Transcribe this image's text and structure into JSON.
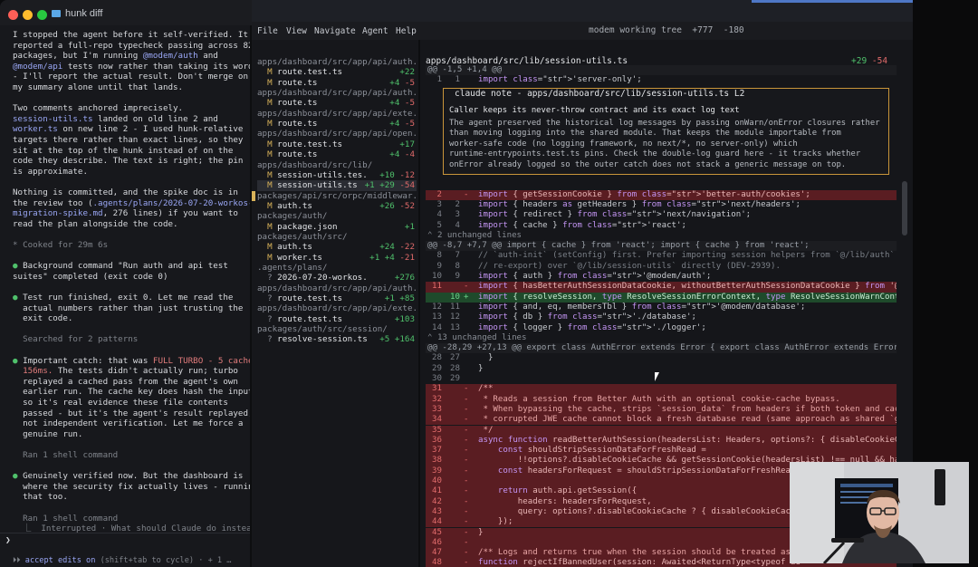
{
  "window": {
    "title": "hunk diff",
    "colors": {
      "close": "#ff5f57",
      "minimize": "#febc2e",
      "maximize": "#28c840",
      "accent": "#4e77c6"
    }
  },
  "chat": {
    "lines": [
      {
        "t": "I stopped the agent before it self-verified. It"
      },
      {
        "t": "reported a full-repo typecheck passing across 82"
      },
      {
        "t": "packages, but I'm running @modem/auth and"
      },
      {
        "t": "@modem/api tests now rather than taking its word"
      },
      {
        "t": "- I'll report the actual result. Don't merge on"
      },
      {
        "t": "my summary alone until that lands."
      },
      {
        "t": ""
      },
      {
        "t": "Two comments anchored imprecisely."
      },
      {
        "t": "session-utils.ts landed on old line 2 and"
      },
      {
        "t": "worker.ts on new line 2 - I used hunk-relative"
      },
      {
        "t": "targets there rather than exact lines, so they"
      },
      {
        "t": "sit at the top of the hunk instead of on the"
      },
      {
        "t": "code they describe. The text is right; the pin"
      },
      {
        "t": "is approximate."
      },
      {
        "t": ""
      },
      {
        "t": "Nothing is committed, and the spike doc is in"
      },
      {
        "t": "the review too (.agents/plans/2026-07-20-workos-"
      },
      {
        "t": "migration-spike.md, 276 lines) if you want to"
      },
      {
        "t": "read the plan alongside the code."
      },
      {
        "t": ""
      },
      {
        "t": "* Cooked for 29m 6s"
      },
      {
        "t": ""
      },
      {
        "t": "● Background command \"Run auth and api test"
      },
      {
        "t": "suites\" completed (exit code 0)"
      },
      {
        "t": ""
      },
      {
        "t": "● Test run finished, exit 0. Let me read the"
      },
      {
        "t": "  actual numbers rather than just trusting the"
      },
      {
        "t": "  exit code."
      },
      {
        "t": ""
      },
      {
        "t": "  Searched for 2 patterns"
      },
      {
        "t": ""
      },
      {
        "t": "● Important catch: that was FULL TURBO - 5 cached,"
      },
      {
        "t": "  156ms. The tests didn't actually run; turbo"
      },
      {
        "t": "  replayed a cached pass from the agent's own"
      },
      {
        "t": "  earlier run. The cache key does hash the inputs,"
      },
      {
        "t": "  so it's real evidence these file contents"
      },
      {
        "t": "  passed - but it's the agent's result replayed,"
      },
      {
        "t": "  not independent verification. Let me force a"
      },
      {
        "t": "  genuine run."
      },
      {
        "t": ""
      },
      {
        "t": "  Ran 1 shell command"
      },
      {
        "t": ""
      },
      {
        "t": "● Genuinely verified now. But the dashboard is"
      },
      {
        "t": "  where the security fix actually lives - running"
      },
      {
        "t": "  that too."
      },
      {
        "t": ""
      },
      {
        "t": "  Ran 1 shell command"
      },
      {
        "t": "  ⎿  Interrupted · What should Claude do instead?"
      }
    ],
    "prompt_symbol": "❯",
    "prompt_value": "",
    "hint_prefix": "⏵⏵ ",
    "hint_accent": "accept edits on",
    "hint_rest": " (shift+tab to cycle) · + 1 …"
  },
  "menu": {
    "items": [
      "File",
      "View",
      "Navigate",
      "Agent",
      "Help"
    ],
    "working_tree": "modem working tree",
    "added": "+777",
    "removed": "-180"
  },
  "files": [
    {
      "kind": "dir",
      "text": "apps/dashboard/src/app/api/auth."
    },
    {
      "kind": "file",
      "st": "M",
      "name": "route.test.ts",
      "plus": "+22",
      "minus": ""
    },
    {
      "kind": "file",
      "st": "M",
      "name": "route.ts",
      "plus": "+4",
      "minus": "-5"
    },
    {
      "kind": "dir",
      "text": "apps/dashboard/src/app/api/auth."
    },
    {
      "kind": "file",
      "st": "M",
      "name": "route.ts",
      "plus": "+4",
      "minus": "-5"
    },
    {
      "kind": "dir",
      "text": "apps/dashboard/src/app/api/exte."
    },
    {
      "kind": "file",
      "st": "M",
      "name": "route.ts",
      "plus": "+4",
      "minus": "-5"
    },
    {
      "kind": "dir",
      "text": "apps/dashboard/src/app/api/open."
    },
    {
      "kind": "file",
      "st": "M",
      "name": "route.test.ts",
      "plus": "+17",
      "minus": ""
    },
    {
      "kind": "file",
      "st": "M",
      "name": "route.ts",
      "plus": "+4",
      "minus": "-4"
    },
    {
      "kind": "dir",
      "text": "apps/dashboard/src/lib/"
    },
    {
      "kind": "file",
      "st": "M",
      "name": "session-utils.tes.",
      "plus": "+10",
      "minus": "-12"
    },
    {
      "kind": "file",
      "st": "M",
      "name": "session-utils.ts",
      "plus": "+1 +29",
      "minus": "-54",
      "sel": true
    },
    {
      "kind": "dir",
      "text": "packages/api/src/orpc/middlewar."
    },
    {
      "kind": "file",
      "st": "M",
      "name": "auth.ts",
      "plus": "+26",
      "minus": "-52"
    },
    {
      "kind": "dir",
      "text": "packages/auth/"
    },
    {
      "kind": "file",
      "st": "M",
      "name": "package.json",
      "plus": "+1",
      "minus": ""
    },
    {
      "kind": "dir",
      "text": "packages/auth/src/"
    },
    {
      "kind": "file",
      "st": "M",
      "name": "auth.ts",
      "plus": "+24",
      "minus": "-22"
    },
    {
      "kind": "file",
      "st": "M",
      "name": "worker.ts",
      "plus": "+1 +4",
      "minus": "-21"
    },
    {
      "kind": "dir",
      "text": ".agents/plans/"
    },
    {
      "kind": "file",
      "st": "?",
      "name": "2026-07-20-workos.",
      "plus": "+276",
      "minus": ""
    },
    {
      "kind": "dir",
      "text": "apps/dashboard/src/app/api/auth."
    },
    {
      "kind": "file",
      "st": "?",
      "name": "route.test.ts",
      "plus": "+1 +85",
      "minus": ""
    },
    {
      "kind": "dir",
      "text": "apps/dashboard/src/app/api/exte."
    },
    {
      "kind": "file",
      "st": "?",
      "name": "route.test.ts",
      "plus": "+103",
      "minus": ""
    },
    {
      "kind": "dir",
      "text": "packages/auth/src/session/"
    },
    {
      "kind": "file",
      "st": "?",
      "name": "resolve-session.ts",
      "plus": "+5 +164",
      "minus": ""
    }
  ],
  "diff": {
    "path": "apps/dashboard/src/lib/session-utils.ts",
    "plus": "+29",
    "minus": "-54",
    "note": {
      "title": "claude note - apps/dashboard/src/lib/session-utils.ts L2",
      "heading": "Caller keeps its never-throw contract and its exact log text",
      "body": [
        "The agent preserved the historical log messages by passing onWarn/onError closures rather",
        "than moving logging into the shared module. That keeps the module importable from",
        "worker-safe code (no logging framework, no next/*, no server-only) which",
        "runtime-entrypoints.test.ts pins. Check the double-log guard here - it tracks whether",
        "onError already logged so the outer catch does not stack a generic message on top."
      ]
    },
    "lines": [
      {
        "type": "hunk",
        "code": "@@ -1,5 +1,4 @@"
      },
      {
        "type": "ctx",
        "o": "1",
        "n": "1",
        "code": "import 'server-only';"
      },
      {
        "type": "del",
        "o": "2",
        "n": "",
        "code": "import { getSessionCookie } from 'better-auth/cookies';"
      },
      {
        "type": "ctx",
        "o": "3",
        "n": "2",
        "code": "import { headers as getHeaders } from 'next/headers';"
      },
      {
        "type": "ctx",
        "o": "4",
        "n": "3",
        "code": "import { redirect } from 'next/navigation';"
      },
      {
        "type": "ctx",
        "o": "5",
        "n": "4",
        "code": "import { cache } from 'react';"
      },
      {
        "type": "unch",
        "code": "⌃ 2 unchanged lines"
      },
      {
        "type": "hunk",
        "code": "@@ -8,7 +7,7 @@ import { cache } from 'react'; import { cache } from 'react';"
      },
      {
        "type": "ctx",
        "o": "8",
        "n": "7",
        "code": "// `auth-init` (setConfig) first. Prefer importing session helpers from `@/lib/auth` ("
      },
      {
        "type": "ctx",
        "o": "9",
        "n": "8",
        "code": "// re-export) over `@/lib/session-utils` directly (DEV-2939)."
      },
      {
        "type": "ctx",
        "o": "10",
        "n": "9",
        "code": "import { auth } from '@modem/auth';"
      },
      {
        "type": "del",
        "o": "11",
        "n": "",
        "code": "import { hasBetterAuthSessionDataCookie, withoutBetterAuthSessionDataCookie } from '@m"
      },
      {
        "type": "add",
        "o": "",
        "n": "10",
        "code": "import { resolveSession, type ResolveSessionErrorContext, type ResolveSessionWarnConte"
      },
      {
        "type": "ctx",
        "o": "12",
        "n": "11",
        "code": "import { and, eq, membersTbl } from '@modem/database';"
      },
      {
        "type": "ctx",
        "o": "13",
        "n": "12",
        "code": "import { db } from './database';"
      },
      {
        "type": "ctx",
        "o": "14",
        "n": "13",
        "code": "import { logger } from './logger';"
      },
      {
        "type": "unch",
        "code": "⌃ 13 unchanged lines"
      },
      {
        "type": "hunk",
        "code": "@@ -28,29 +27,13 @@ export class AuthError extends Error { export class AuthError extends Error {"
      },
      {
        "type": "ctx",
        "o": "28",
        "n": "27",
        "code": "  }"
      },
      {
        "type": "ctx",
        "o": "29",
        "n": "28",
        "code": "}"
      },
      {
        "type": "ctx",
        "o": "30",
        "n": "29",
        "code": ""
      },
      {
        "type": "del",
        "o": "31",
        "n": "",
        "code": "/**"
      },
      {
        "type": "del",
        "o": "32",
        "n": "",
        "code": " * Reads a session from Better Auth with an optional cookie-cache bypass."
      },
      {
        "type": "del",
        "o": "33",
        "n": "",
        "code": " * When bypassing the cache, strips `session_data` from headers if both token and cach"
      },
      {
        "type": "del",
        "o": "34",
        "n": "",
        "code": " * corrupted JWE cache cannot block a fresh database read (same approach as shared `ge"
      },
      {
        "type": "del",
        "o": "35",
        "n": "",
        "code": " */"
      },
      {
        "type": "del",
        "o": "36",
        "n": "",
        "code": "async function readBetterAuthSession(headersList: Headers, options?: { disableCookieCa"
      },
      {
        "type": "del",
        "o": "37",
        "n": "",
        "code": "    const shouldStripSessionDataForFreshRead ="
      },
      {
        "type": "del",
        "o": "38",
        "n": "",
        "code": "        !!options?.disableCookieCache && getSessionCookie(headersList) !== null && has"
      },
      {
        "type": "del",
        "o": "39",
        "n": "",
        "code": "    const headersForRequest = shouldStripSessionDataForFreshRead ? withoutBetterAuthSe"
      },
      {
        "type": "del",
        "o": "40",
        "n": "",
        "code": ""
      },
      {
        "type": "del",
        "o": "41",
        "n": "",
        "code": "    return auth.api.getSession({"
      },
      {
        "type": "del",
        "o": "42",
        "n": "",
        "code": "        headers: headersForRequest,"
      },
      {
        "type": "del",
        "o": "43",
        "n": "",
        "code": "        query: options?.disableCookieCache ? { disableCookieCache"
      },
      {
        "type": "del",
        "o": "44",
        "n": "",
        "code": "    });"
      },
      {
        "type": "del",
        "o": "45",
        "n": "",
        "code": "}"
      },
      {
        "type": "del",
        "o": "46",
        "n": "",
        "code": ""
      },
      {
        "type": "del",
        "o": "47",
        "n": "",
        "code": "/** Logs and returns true when the session should be treated as u"
      },
      {
        "type": "del",
        "o": "48",
        "n": "",
        "code": "function rejectIfBannedUser(session: Awaited<ReturnType<typeof au"
      }
    ]
  }
}
